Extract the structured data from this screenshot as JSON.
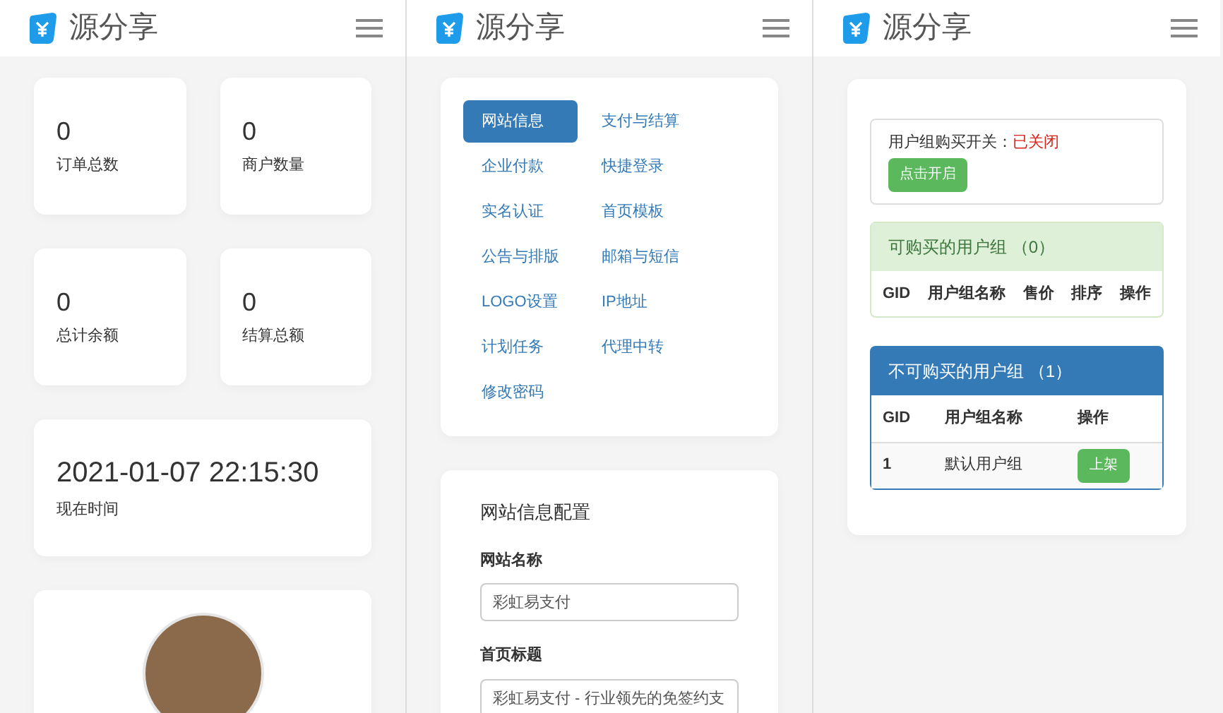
{
  "screens": [
    {
      "brand": "源分享"
    },
    {
      "brand": "源分享"
    },
    {
      "brand": "源分享"
    }
  ],
  "stats": [
    {
      "value": "0",
      "label": "订单总数"
    },
    {
      "value": "0",
      "label": "商户数量"
    },
    {
      "value": "0",
      "label": "总计余额"
    },
    {
      "value": "0",
      "label": "结算总额"
    }
  ],
  "clock": {
    "value": "2021-01-07 22:15:30",
    "label": "现在时间"
  },
  "settings_tabs": [
    {
      "label": "网站信息",
      "selected": true
    },
    {
      "label": "支付与结算",
      "selected": false
    },
    {
      "label": "企业付款",
      "selected": false
    },
    {
      "label": "快捷登录",
      "selected": false
    },
    {
      "label": "实名认证",
      "selected": false
    },
    {
      "label": "首页模板",
      "selected": false
    },
    {
      "label": "公告与排版",
      "selected": false
    },
    {
      "label": "邮箱与短信",
      "selected": false
    },
    {
      "label": "LOGO设置",
      "selected": false
    },
    {
      "label": "IP地址",
      "selected": false
    },
    {
      "label": "计划任务",
      "selected": false
    },
    {
      "label": "代理中转",
      "selected": false
    },
    {
      "label": "修改密码",
      "selected": false
    }
  ],
  "site_config": {
    "title": "网站信息配置",
    "fields": [
      {
        "label": "网站名称",
        "value": "彩虹易支付"
      },
      {
        "label": "首页标题",
        "value": "彩虹易支付 - 行业领先的免签约支"
      }
    ]
  },
  "purchase_switch": {
    "label": "用户组购买开关：",
    "status": "已关闭",
    "button": "点击开启"
  },
  "buyable_groups": {
    "title": "可购买的用户组 （0）",
    "columns": [
      "GID",
      "用户组名称",
      "售价",
      "排序",
      "操作"
    ]
  },
  "unbuyable_groups": {
    "title": "不可购买的用户组 （1）",
    "columns": [
      "GID",
      "用户组名称",
      "操作"
    ],
    "rows": [
      {
        "gid": "1",
        "name": "默认用户组",
        "action": "上架"
      }
    ]
  }
}
